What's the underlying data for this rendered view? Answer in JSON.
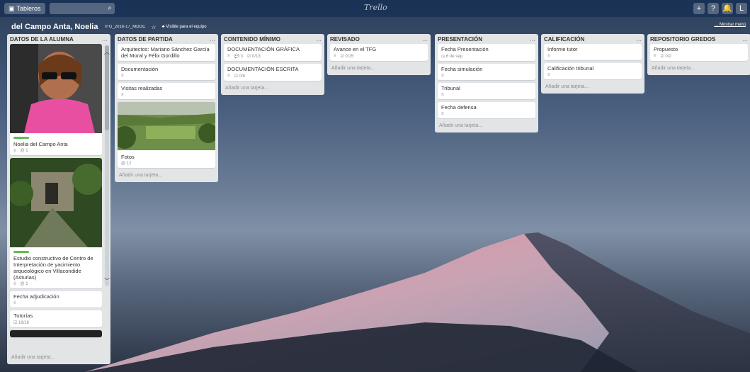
{
  "topbar": {
    "boards_label": "Tableros",
    "logo": "Trello",
    "right_buttons": [
      "+",
      "?",
      "🔔",
      "L"
    ]
  },
  "board": {
    "title": "del Campo Anta, Noelia",
    "org": "TFG_2016-17_MDGC",
    "visibility": "Visible para el equipo",
    "menu_link": "Mostrar menú"
  },
  "lists": [
    {
      "title": "DATOS DE LA ALUMNA",
      "cards": [
        {
          "title": "Noelia del Campo Anta",
          "badges": [
            "≡",
            "@ 1"
          ]
        },
        {
          "title": "Estudio constructivo de Centro de Interpretación de yacimiento arqueológico en Villacondide (Asturias)",
          "badges": [
            "≡",
            "@ 1"
          ]
        },
        {
          "title": "Fecha adjudicación",
          "badges": [
            "≡"
          ]
        },
        {
          "title": "Tutorías",
          "badges": [
            "☑ 16/16"
          ]
        }
      ],
      "add": "Añadir una tarjeta..."
    },
    {
      "title": "DATOS DE PARTIDA",
      "cards": [
        {
          "title": "Arquitectos: Mariano Sánchez García del Moral y Félix Gordillo",
          "badges": []
        },
        {
          "title": "Documentación",
          "badges": [
            "≡"
          ]
        },
        {
          "title": "Visitas realizadas",
          "badges": [
            "≡"
          ]
        },
        {
          "title": "Fotos",
          "badges": [
            "@ 12"
          ]
        }
      ],
      "add": "Añadir una tarjeta..."
    },
    {
      "title": "CONTENIDO MÍNIMO",
      "cards": [
        {
          "title": "DOCUMENTACIÓN GRÁFICA",
          "badges": [
            "≡",
            "💬 3",
            "☑ 0/13"
          ]
        },
        {
          "title": "DOCUMENTACIÓN ESCRITA",
          "badges": [
            "≡",
            "☑ 0/8"
          ]
        }
      ],
      "add": "Añadir una tarjeta..."
    },
    {
      "title": "REVISADO",
      "cards": [
        {
          "title": "Avance en el TFG",
          "badges": [
            "≡",
            "☑ 0/15"
          ]
        }
      ],
      "add": "Añadir una tarjeta..."
    },
    {
      "title": "PRESENTACIÓN",
      "cards": [
        {
          "title": "Fecha Presentación",
          "badges": [
            "◷ 6 de sep."
          ]
        },
        {
          "title": "Fecha simulación",
          "badges": [
            "≡"
          ]
        },
        {
          "title": "Tribunal",
          "badges": [
            "≡"
          ]
        },
        {
          "title": "Fecha defensa",
          "badges": [
            "≡"
          ]
        }
      ],
      "add": "Añadir una tarjeta..."
    },
    {
      "title": "CALIFICACIÓN",
      "cards": [
        {
          "title": "Informe tutor",
          "badges": [
            "≡"
          ]
        },
        {
          "title": "Calificación tribunal",
          "badges": [
            "≡"
          ]
        }
      ],
      "add": "Añadir una tarjeta..."
    },
    {
      "title": "REPOSITORIO GREDOS",
      "cards": [
        {
          "title": "Propuesto",
          "badges": [
            "≡",
            "☑ 0/2"
          ]
        }
      ],
      "add": "Añadir una tarjeta..."
    }
  ],
  "colors": {
    "list_bg": "#e2e4e6",
    "label_green": "#61bd4f",
    "topbar": "#0c2850"
  }
}
